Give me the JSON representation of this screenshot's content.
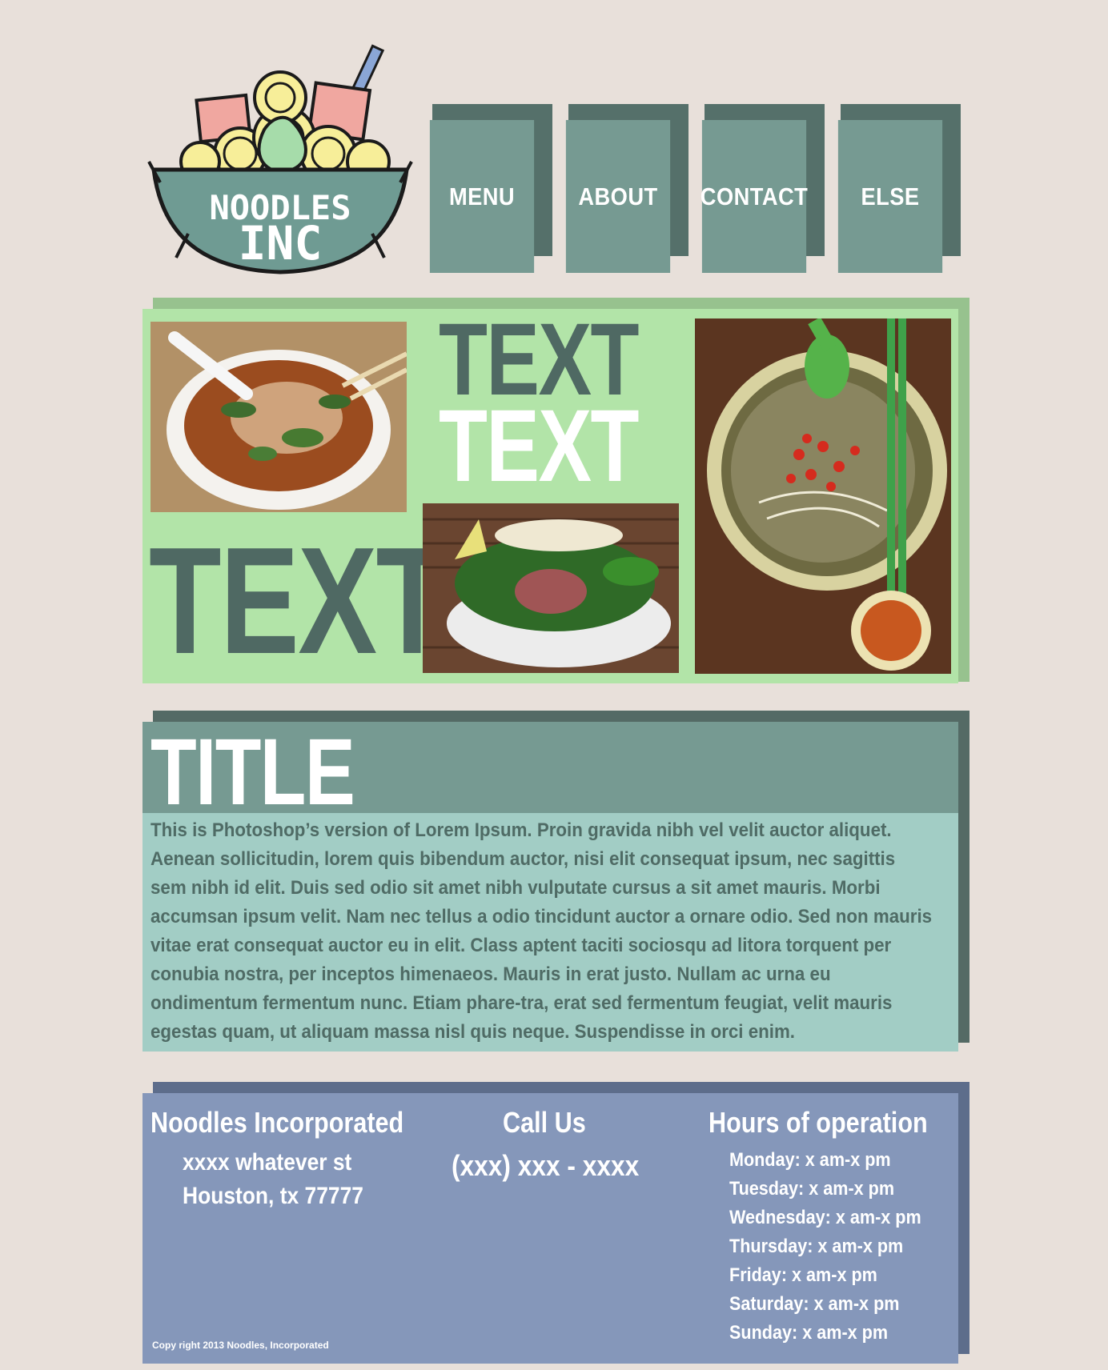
{
  "brand": {
    "line1": "NOODLES",
    "line2": "INC"
  },
  "nav": [
    {
      "label": "MENU"
    },
    {
      "label": "ABOUT"
    },
    {
      "label": "CONTACT"
    },
    {
      "label": "ELSE"
    }
  ],
  "hero": {
    "text_top_dark": "TEXT",
    "text_top_white": "TEXT",
    "text_bottom_left": "TEXT",
    "images": [
      "pho-bowl-photo",
      "beef-pho-photo",
      "pho-with-chilies-photo"
    ]
  },
  "article": {
    "title": "TITLE",
    "body": "This is Photoshop’s version  of Lorem Ipsum. Proin gravida nibh vel velit auctor aliquet. Aenean sollicitudin, lorem quis bibendum auctor, nisi elit consequat ipsum, nec sagittis sem nibh id elit. Duis sed odio sit amet nibh vulputate cursus a sit amet mauris. Morbi accumsan ipsum velit. Nam nec tellus a odio tincidunt auctor a ornare odio. Sed non  mauris vitae erat consequat auctor eu in elit. Class aptent taciti sociosqu ad litora torquent per conubia nostra, per inceptos himenaeos. Mauris in erat justo. Nullam ac urna eu ondimentum fermentum nunc. Etiam phare-tra, erat sed fermentum feugiat, velit mauris egestas quam, ut aliquam massa nisl quis neque. Suspendisse in orci enim."
  },
  "footer": {
    "company": "Noodles Incorporated",
    "address1": "xxxx whatever st",
    "address2": "Houston, tx 77777",
    "call_heading": "Call Us",
    "phone": "(xxx) xxx - xxxx",
    "hours_heading": "Hours of operation",
    "hours": [
      "Monday: x am-x pm",
      "Tuesday: x am-x pm",
      "Wednesday: x am-x pm",
      "Thursday: x am-x pm",
      "Friday: x am-x pm",
      "Saturday: x am-x pm",
      "Sunday: x am-x pm"
    ],
    "copyright": "Copy right 2013 Noodles, Incorporated"
  },
  "colors": {
    "page_bg": "#e8e0da",
    "nav_face": "#769a92",
    "nav_shadow": "#55706a",
    "hero_bg": "#b2e4a8",
    "dark_text": "#4f6963",
    "article_body": "#a2cdc5",
    "footer_bg": "#8597ba"
  }
}
